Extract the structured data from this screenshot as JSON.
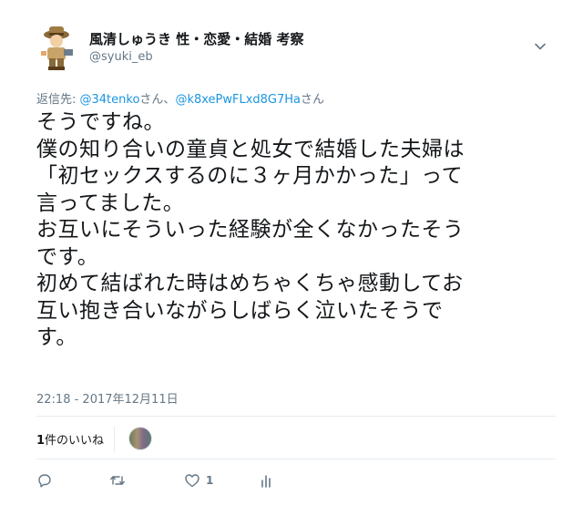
{
  "user": {
    "display_name": "風清しゅうき 性・恋愛・結婚 考察",
    "handle": "@syuki_eb",
    "avatar_icon": "explorer-avatar-icon"
  },
  "reply_context": {
    "prefix": "返信先: ",
    "mention1": "@34tenko",
    "sep1": "さん、",
    "mention2": "@k8xePwFLxd8G7Ha",
    "sep2": "さん",
    "link_color": "#1b95e0"
  },
  "tweet": {
    "lines": [
      "そうですね。",
      "僕の知り合いの童貞と処女で結婚した夫婦は",
      "「初セックスするのに３ヶ月かかった」って",
      "言ってました。",
      "お互いにそういった経験が全くなかったそう",
      "です。",
      "初めて結ばれた時はめちゃくちゃ感動してお",
      "互い抱き合いながらしばらく泣いたそうで",
      "す。"
    ],
    "timestamp": "22:18 - 2017年12月11日"
  },
  "likes": {
    "count": "1",
    "label": "件のいいね"
  },
  "actions": {
    "reply_icon": "reply-icon",
    "retweet_icon": "retweet-icon",
    "like_icon": "heart-icon",
    "like_count": "1",
    "analytics_icon": "analytics-icon"
  },
  "colors": {
    "text": "#14171a",
    "muted": "#657786",
    "divider": "#e6ecf0"
  }
}
